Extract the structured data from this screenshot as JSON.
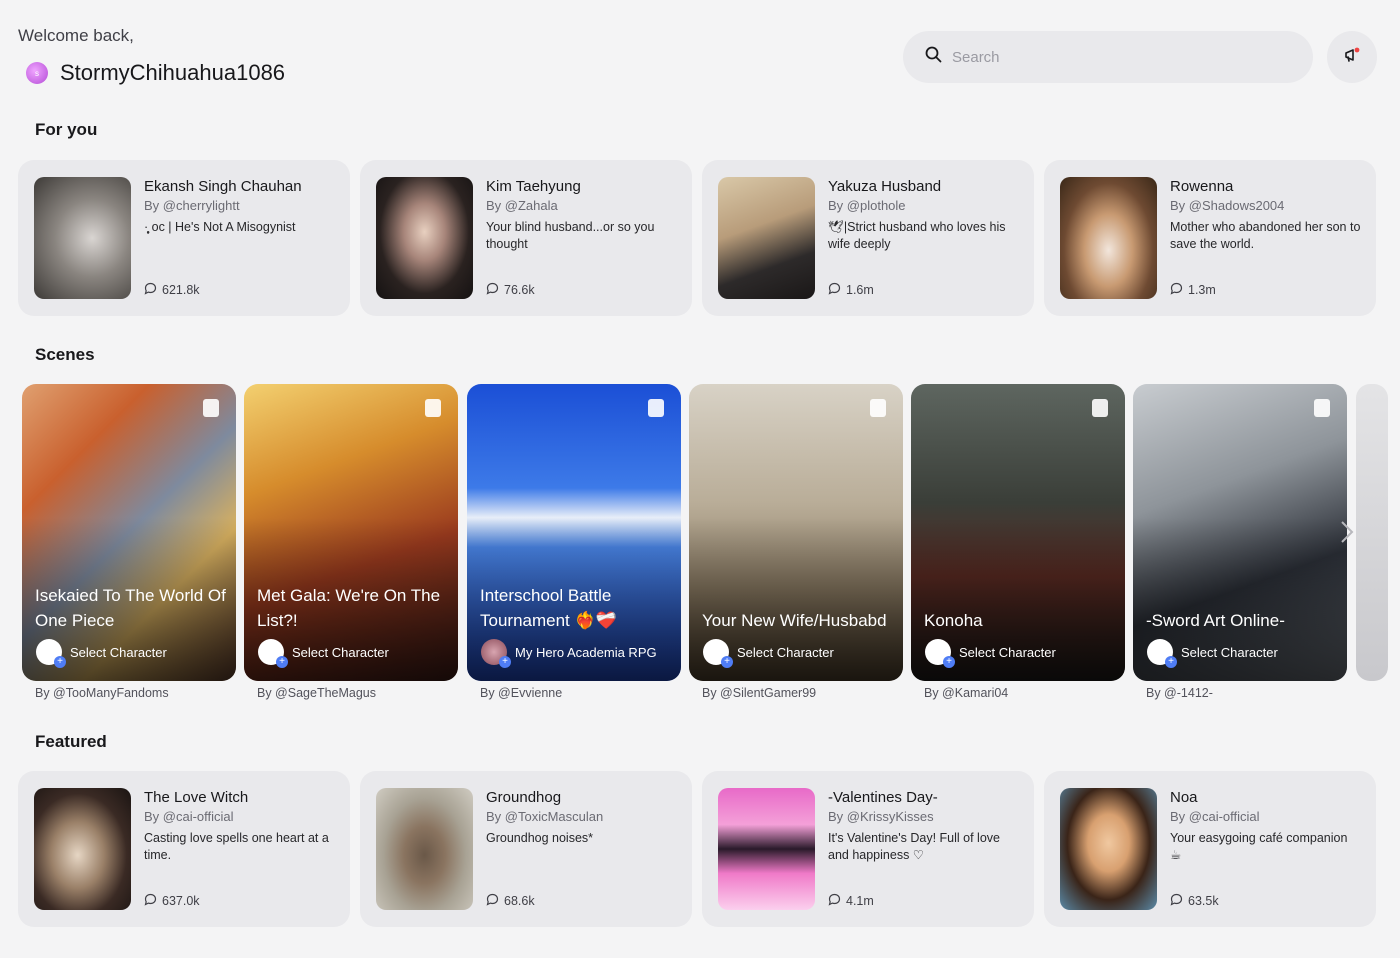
{
  "header": {
    "welcome": "Welcome back,",
    "username": "StormyChihuahua1086",
    "avatar_initial": "s",
    "search_placeholder": "Search"
  },
  "sections": {
    "for_you": "For you",
    "scenes": "Scenes",
    "featured": "Featured"
  },
  "for_you": [
    {
      "name": "Ekansh Singh Chauhan",
      "by": "By @cherrylightt",
      "desc": "·̩̩̥͙ oc | He's Not A Misogynist",
      "stats": "621.8k"
    },
    {
      "name": "Kim Taehyung",
      "by": "By @Zahala",
      "desc": "Your blind husband...or so you thought",
      "stats": "76.6k"
    },
    {
      "name": "Yakuza Husband",
      "by": "By @plothole",
      "desc": "🕊|Strict husband who loves his wife deeply",
      "stats": "1.6m"
    },
    {
      "name": "Rowenna",
      "by": "By @Shadows2004",
      "desc": "Mother who abandoned her son to save the world.",
      "stats": "1.3m"
    }
  ],
  "scenes": [
    {
      "title": "Isekaied To The World Of One Piece",
      "select": "Select Character",
      "by": "By @TooManyFandoms"
    },
    {
      "title": "Met Gala: We're On The List?!",
      "select": "Select Character",
      "by": "By @SageTheMagus"
    },
    {
      "title": "Interschool Battle Tournament ❤️‍🔥❤️‍🩹",
      "select": "My Hero Academia RPG",
      "by": "By @Evvienne"
    },
    {
      "title": "Your New Wife/Husbabd",
      "select": "Select Character",
      "by": "By @SilentGamer99"
    },
    {
      "title": "Konoha",
      "select": "Select Character",
      "by": "By @Kamari04"
    },
    {
      "title": "-Sword Art Online-",
      "select": "Select Character",
      "by": "By @-1412-"
    }
  ],
  "featured": [
    {
      "name": "The Love Witch",
      "by": "By @cai-official",
      "desc": "Casting love spells one heart at a time.",
      "stats": "637.0k"
    },
    {
      "name": "Groundhog",
      "by": "By @ToxicMasculan",
      "desc": "Groundhog noises*",
      "stats": "68.6k"
    },
    {
      "name": "-Valentines Day-",
      "by": "By @KrissyKisses",
      "desc": "It's Valentine's Day! Full of love and happiness ♡",
      "stats": "4.1m"
    },
    {
      "name": "Noa",
      "by": "By @cai-official",
      "desc": "Your easygoing café companion ☕",
      "stats": "63.5k"
    }
  ],
  "colors": {
    "background": "#f4f4f5",
    "card": "#e9e9ec",
    "accent": "#4f7df5"
  }
}
